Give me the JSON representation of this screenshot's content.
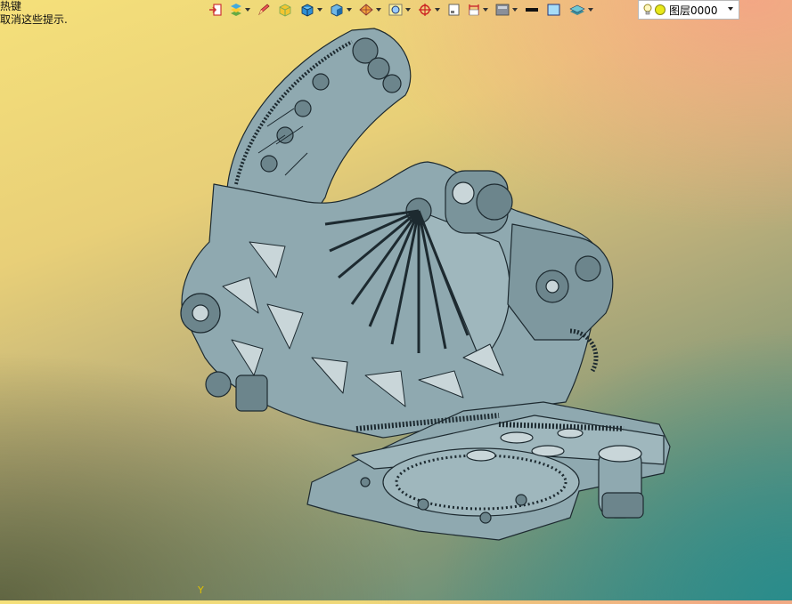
{
  "hint": {
    "line1": "热键",
    "line2": "取消这些提示."
  },
  "toolbar": {
    "items": [
      {
        "icon": "exit-icon"
      },
      {
        "icon": "layers-icon",
        "dropdown": true
      },
      {
        "icon": "pencil-icon"
      },
      {
        "icon": "solid-box-icon"
      },
      {
        "icon": "cube-icon",
        "dropdown": true
      },
      {
        "icon": "shaded-cube-icon",
        "dropdown": true
      },
      {
        "icon": "render-style-icon",
        "dropdown": true
      },
      {
        "icon": "zoom-fit-icon",
        "dropdown": true
      },
      {
        "icon": "crosshair-icon",
        "dropdown": true
      },
      {
        "icon": "page-icon"
      },
      {
        "icon": "section-icon",
        "dropdown": true
      },
      {
        "icon": "display-mode-icon",
        "dropdown": true
      },
      {
        "icon": "line-color-icon"
      },
      {
        "icon": "fill-color-icon"
      },
      {
        "icon": "layer-stack-icon",
        "dropdown": true
      }
    ]
  },
  "layer": {
    "name": "图层0000",
    "light": "lightbulb-icon",
    "state": "sun-icon"
  },
  "axis": {
    "y_label": "Y"
  },
  "colors": {
    "model": "#8fa9b0",
    "outline": "#1d2a30"
  }
}
